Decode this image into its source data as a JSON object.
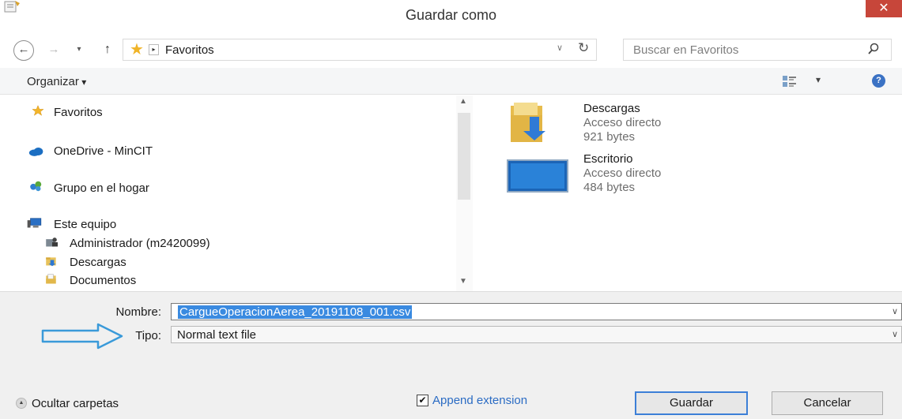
{
  "window": {
    "title": "Guardar como",
    "close_symbol": "✕"
  },
  "address_bar": {
    "back_symbol": "←",
    "forward_symbol": "→",
    "recent_symbol": "▾",
    "up_symbol": "↑",
    "breadcrumb_arrow": "▸",
    "location": "Favoritos",
    "dropdown_symbol": "∨",
    "refresh_symbol": "↻"
  },
  "search": {
    "placeholder": "Buscar en Favoritos",
    "icon": "search-icon"
  },
  "toolbar": {
    "organize_label": "Organizar",
    "help_symbol": "?",
    "view_drop_symbol": "▾"
  },
  "nav_pane": {
    "items": [
      {
        "label": "Favoritos",
        "icon": "star-icon"
      },
      {
        "label": "OneDrive - MinCIT",
        "icon": "cloud-icon"
      },
      {
        "label": "Grupo en el hogar",
        "icon": "homegroup-icon"
      },
      {
        "label": "Este equipo",
        "icon": "computer-icon"
      },
      {
        "label": "Administrador (m2420099)",
        "icon": "user-folder-icon"
      },
      {
        "label": "Descargas",
        "icon": "downloads-folder-icon"
      },
      {
        "label": "Documentos",
        "icon": "documents-folder-icon"
      }
    ]
  },
  "files": [
    {
      "name": "Descargas",
      "type": "Acceso directo",
      "size": "921 bytes",
      "icon": "downloads-folder-icon"
    },
    {
      "name": "Escritorio",
      "type": "Acceso directo",
      "size": "484 bytes",
      "icon": "desktop-icon"
    }
  ],
  "form": {
    "name_label": "Nombre:",
    "name_value": "CargueOperacionAerea_20191108_001.csv",
    "type_label": "Tipo:",
    "type_value": "Normal text file",
    "dropdown_symbol": "∨"
  },
  "footer": {
    "hide_folders_label": "Ocultar carpetas",
    "append_extension_label": "Append extension",
    "append_extension_checked": true,
    "check_symbol": "✔",
    "save_label": "Guardar",
    "cancel_label": "Cancelar"
  },
  "colors": {
    "selection": "#3a8ae0",
    "close_button": "#c7463a",
    "annotation_arrow": "#3a9ad9",
    "link_blue": "#2b6cc4"
  }
}
